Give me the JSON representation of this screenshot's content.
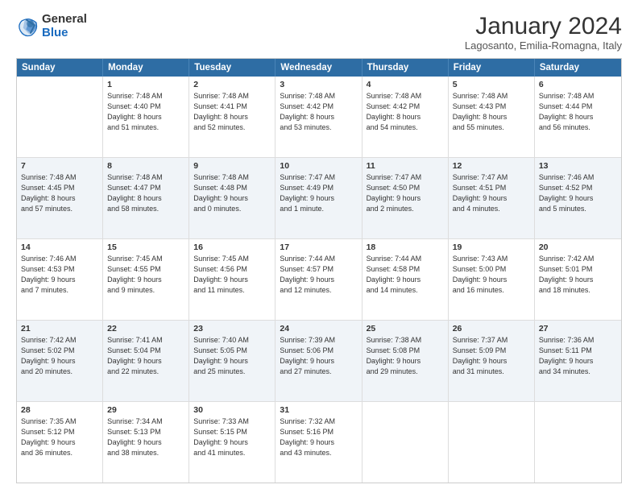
{
  "logo": {
    "general": "General",
    "blue": "Blue"
  },
  "title": "January 2024",
  "subtitle": "Lagosanto, Emilia-Romagna, Italy",
  "header_days": [
    "Sunday",
    "Monday",
    "Tuesday",
    "Wednesday",
    "Thursday",
    "Friday",
    "Saturday"
  ],
  "weeks": [
    [
      {
        "day": "",
        "info": ""
      },
      {
        "day": "1",
        "info": "Sunrise: 7:48 AM\nSunset: 4:40 PM\nDaylight: 8 hours\nand 51 minutes."
      },
      {
        "day": "2",
        "info": "Sunrise: 7:48 AM\nSunset: 4:41 PM\nDaylight: 8 hours\nand 52 minutes."
      },
      {
        "day": "3",
        "info": "Sunrise: 7:48 AM\nSunset: 4:42 PM\nDaylight: 8 hours\nand 53 minutes."
      },
      {
        "day": "4",
        "info": "Sunrise: 7:48 AM\nSunset: 4:42 PM\nDaylight: 8 hours\nand 54 minutes."
      },
      {
        "day": "5",
        "info": "Sunrise: 7:48 AM\nSunset: 4:43 PM\nDaylight: 8 hours\nand 55 minutes."
      },
      {
        "day": "6",
        "info": "Sunrise: 7:48 AM\nSunset: 4:44 PM\nDaylight: 8 hours\nand 56 minutes."
      }
    ],
    [
      {
        "day": "7",
        "info": "Sunrise: 7:48 AM\nSunset: 4:45 PM\nDaylight: 8 hours\nand 57 minutes."
      },
      {
        "day": "8",
        "info": "Sunrise: 7:48 AM\nSunset: 4:47 PM\nDaylight: 8 hours\nand 58 minutes."
      },
      {
        "day": "9",
        "info": "Sunrise: 7:48 AM\nSunset: 4:48 PM\nDaylight: 9 hours\nand 0 minutes."
      },
      {
        "day": "10",
        "info": "Sunrise: 7:47 AM\nSunset: 4:49 PM\nDaylight: 9 hours\nand 1 minute."
      },
      {
        "day": "11",
        "info": "Sunrise: 7:47 AM\nSunset: 4:50 PM\nDaylight: 9 hours\nand 2 minutes."
      },
      {
        "day": "12",
        "info": "Sunrise: 7:47 AM\nSunset: 4:51 PM\nDaylight: 9 hours\nand 4 minutes."
      },
      {
        "day": "13",
        "info": "Sunrise: 7:46 AM\nSunset: 4:52 PM\nDaylight: 9 hours\nand 5 minutes."
      }
    ],
    [
      {
        "day": "14",
        "info": "Sunrise: 7:46 AM\nSunset: 4:53 PM\nDaylight: 9 hours\nand 7 minutes."
      },
      {
        "day": "15",
        "info": "Sunrise: 7:45 AM\nSunset: 4:55 PM\nDaylight: 9 hours\nand 9 minutes."
      },
      {
        "day": "16",
        "info": "Sunrise: 7:45 AM\nSunset: 4:56 PM\nDaylight: 9 hours\nand 11 minutes."
      },
      {
        "day": "17",
        "info": "Sunrise: 7:44 AM\nSunset: 4:57 PM\nDaylight: 9 hours\nand 12 minutes."
      },
      {
        "day": "18",
        "info": "Sunrise: 7:44 AM\nSunset: 4:58 PM\nDaylight: 9 hours\nand 14 minutes."
      },
      {
        "day": "19",
        "info": "Sunrise: 7:43 AM\nSunset: 5:00 PM\nDaylight: 9 hours\nand 16 minutes."
      },
      {
        "day": "20",
        "info": "Sunrise: 7:42 AM\nSunset: 5:01 PM\nDaylight: 9 hours\nand 18 minutes."
      }
    ],
    [
      {
        "day": "21",
        "info": "Sunrise: 7:42 AM\nSunset: 5:02 PM\nDaylight: 9 hours\nand 20 minutes."
      },
      {
        "day": "22",
        "info": "Sunrise: 7:41 AM\nSunset: 5:04 PM\nDaylight: 9 hours\nand 22 minutes."
      },
      {
        "day": "23",
        "info": "Sunrise: 7:40 AM\nSunset: 5:05 PM\nDaylight: 9 hours\nand 25 minutes."
      },
      {
        "day": "24",
        "info": "Sunrise: 7:39 AM\nSunset: 5:06 PM\nDaylight: 9 hours\nand 27 minutes."
      },
      {
        "day": "25",
        "info": "Sunrise: 7:38 AM\nSunset: 5:08 PM\nDaylight: 9 hours\nand 29 minutes."
      },
      {
        "day": "26",
        "info": "Sunrise: 7:37 AM\nSunset: 5:09 PM\nDaylight: 9 hours\nand 31 minutes."
      },
      {
        "day": "27",
        "info": "Sunrise: 7:36 AM\nSunset: 5:11 PM\nDaylight: 9 hours\nand 34 minutes."
      }
    ],
    [
      {
        "day": "28",
        "info": "Sunrise: 7:35 AM\nSunset: 5:12 PM\nDaylight: 9 hours\nand 36 minutes."
      },
      {
        "day": "29",
        "info": "Sunrise: 7:34 AM\nSunset: 5:13 PM\nDaylight: 9 hours\nand 38 minutes."
      },
      {
        "day": "30",
        "info": "Sunrise: 7:33 AM\nSunset: 5:15 PM\nDaylight: 9 hours\nand 41 minutes."
      },
      {
        "day": "31",
        "info": "Sunrise: 7:32 AM\nSunset: 5:16 PM\nDaylight: 9 hours\nand 43 minutes."
      },
      {
        "day": "",
        "info": ""
      },
      {
        "day": "",
        "info": ""
      },
      {
        "day": "",
        "info": ""
      }
    ]
  ]
}
